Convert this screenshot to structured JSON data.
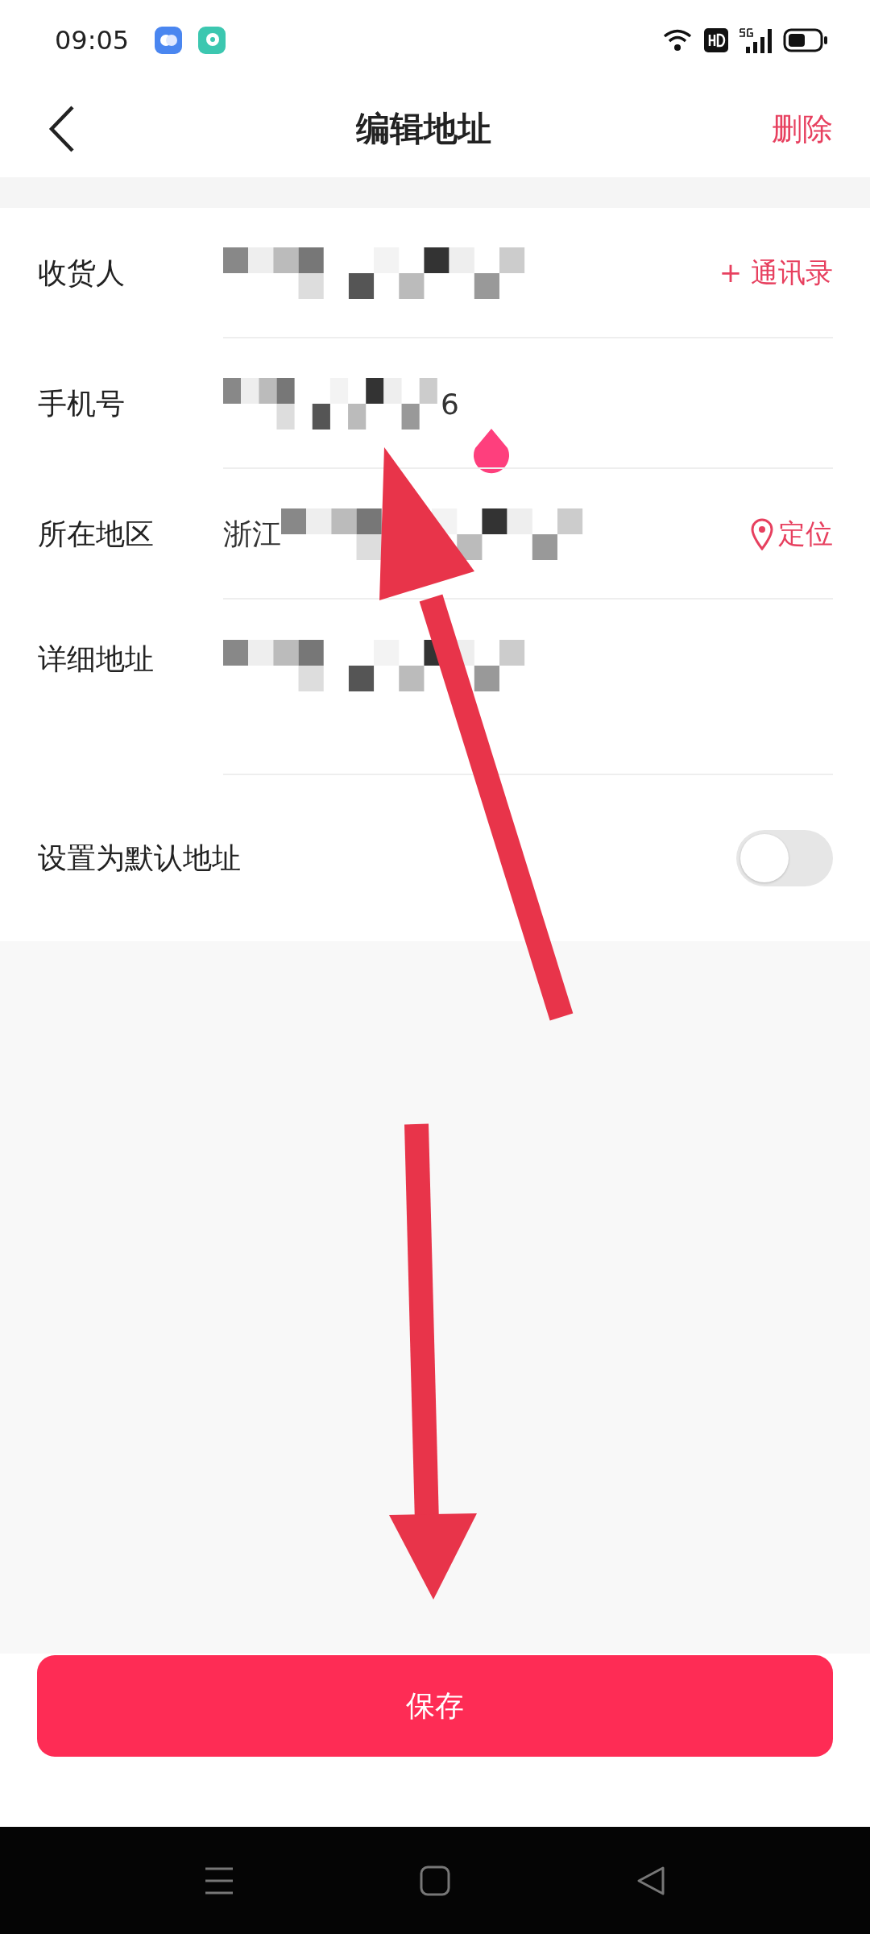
{
  "status_bar": {
    "time": "09:05"
  },
  "header": {
    "title": "编辑地址",
    "action": "删除"
  },
  "fields": [
    {
      "label": "收货人",
      "redacted": true,
      "action": {
        "kind": "contacts",
        "text": "+ 通讯录"
      }
    },
    {
      "label": "手机号",
      "redacted": true,
      "value_after": "6",
      "cursor": true
    },
    {
      "label": "所在地区",
      "value_before": "浙江",
      "redacted": true,
      "action": {
        "kind": "locate",
        "text": "定位"
      }
    },
    {
      "label": "详细地址",
      "redacted": true,
      "multiline": true
    }
  ],
  "default_address": {
    "label": "设置为默认地址",
    "on": false
  },
  "save_button": "保存"
}
